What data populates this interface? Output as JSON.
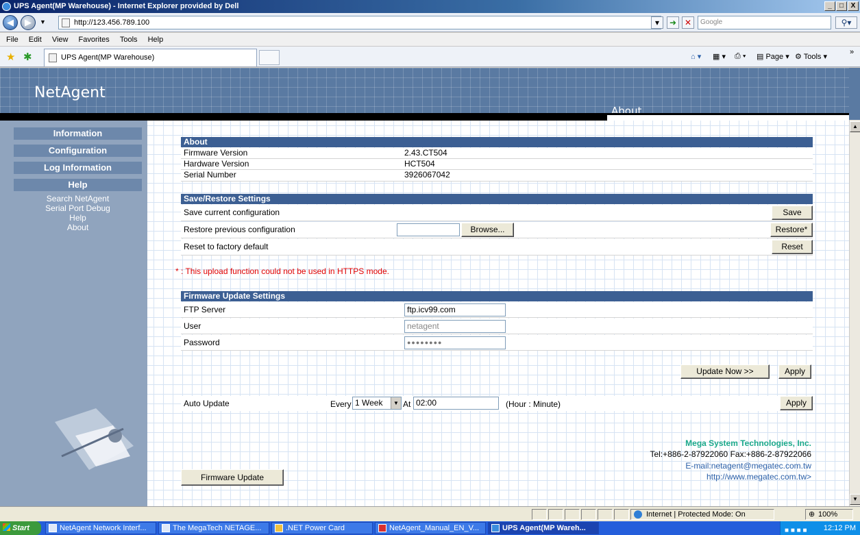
{
  "window": {
    "title": "UPS Agent(MP Warehouse) - Internet Explorer provided by Dell",
    "minimize": "_",
    "restore": "□",
    "close": "X"
  },
  "address_bar": {
    "url": "http://123.456.789.100",
    "search_placeholder": "Google"
  },
  "menu": [
    "File",
    "Edit",
    "View",
    "Favorites",
    "Tools",
    "Help"
  ],
  "tab": {
    "title": "UPS Agent(MP Warehouse)"
  },
  "toolbar": {
    "page": "Page",
    "tools": "Tools",
    "more": "»"
  },
  "banner": {
    "logo": "NetAgent",
    "section": "About"
  },
  "sidebar": {
    "heads": [
      "Information",
      "Configuration",
      "Log Information",
      "Help"
    ],
    "help_links": [
      "Search NetAgent",
      "Serial Port Debug",
      "Help",
      "About"
    ]
  },
  "about": {
    "title": "About",
    "rows": [
      {
        "label": "Firmware Version",
        "value": "2.43.CT504"
      },
      {
        "label": "Hardware Version",
        "value": "HCT504"
      },
      {
        "label": "Serial Number",
        "value": "3926067042"
      }
    ]
  },
  "save_restore": {
    "title": "Save/Restore Settings",
    "save_label": "Save current configuration",
    "save_button": "Save",
    "restore_label": "Restore previous configuration",
    "browse_button": "Browse...",
    "restore_button": "Restore*",
    "reset_label": "Reset to factory default",
    "reset_button": "Reset",
    "note": "* : This upload function could not be used in HTTPS mode."
  },
  "firmware": {
    "title": "Firmware Update Settings",
    "ftp_label": "FTP Server",
    "ftp_value": "ftp.icv99.com",
    "user_label": "User",
    "user_value": "netagent",
    "password_label": "Password",
    "password_value": "●●●●●●●●",
    "update_now_button": "Update Now >>",
    "apply_button": "Apply"
  },
  "auto_update": {
    "label": "Auto Update",
    "every": "Every",
    "interval": "1 Week",
    "at": "At",
    "time": "02:00",
    "hint": "(Hour : Minute)",
    "apply_button": "Apply"
  },
  "firmware_update_button": "Firmware Update",
  "company": {
    "name": "Mega System Technologies, Inc.",
    "tel": "Tel:+886-2-87922060 Fax:+886-2-87922066",
    "email": "E-mail:netagent@megatec.com.tw",
    "web": "http://www.megatec.com.tw>"
  },
  "status": {
    "zone": "Internet | Protected Mode: On",
    "zoom": "100%"
  },
  "taskbar": {
    "start": "Start",
    "tasks": [
      "NetAgent Network Interf...",
      "The MegaTech  NETAGE...",
      ".NET Power Card",
      "NetAgent_Manual_EN_V...",
      "UPS Agent(MP Wareh..."
    ],
    "time": "12:12 PM"
  },
  "colors": {
    "banner": "#5a7aa2",
    "section_head": "#3c5f93",
    "sidebar": "#90a4be",
    "company_name": "#1aa88a",
    "note": "#e00000"
  }
}
